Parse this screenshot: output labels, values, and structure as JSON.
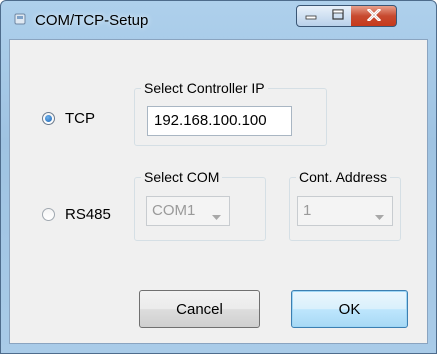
{
  "window": {
    "title": "COM/TCP-Setup",
    "icon": "app-icon",
    "controls": {
      "minimize_icon": "minimize-icon",
      "maximize_icon": "maximize-icon",
      "close_icon": "close-icon"
    }
  },
  "tcp": {
    "radio_label": "TCP",
    "selected": true,
    "group_label": "Select Controller IP",
    "ip_value": "192.168.100.100"
  },
  "rs485": {
    "radio_label": "RS485",
    "selected": false,
    "com_group_label": "Select COM",
    "com_value": "COM1",
    "address_group_label": "Cont. Address",
    "address_value": "1"
  },
  "buttons": {
    "cancel_label": "Cancel",
    "ok_label": "OK"
  },
  "colors": {
    "titlebar": "#a9cbe8",
    "close_button": "#c74a30",
    "dialog_background": "#f0f0f0",
    "radio_selected": "#1b63b3"
  }
}
